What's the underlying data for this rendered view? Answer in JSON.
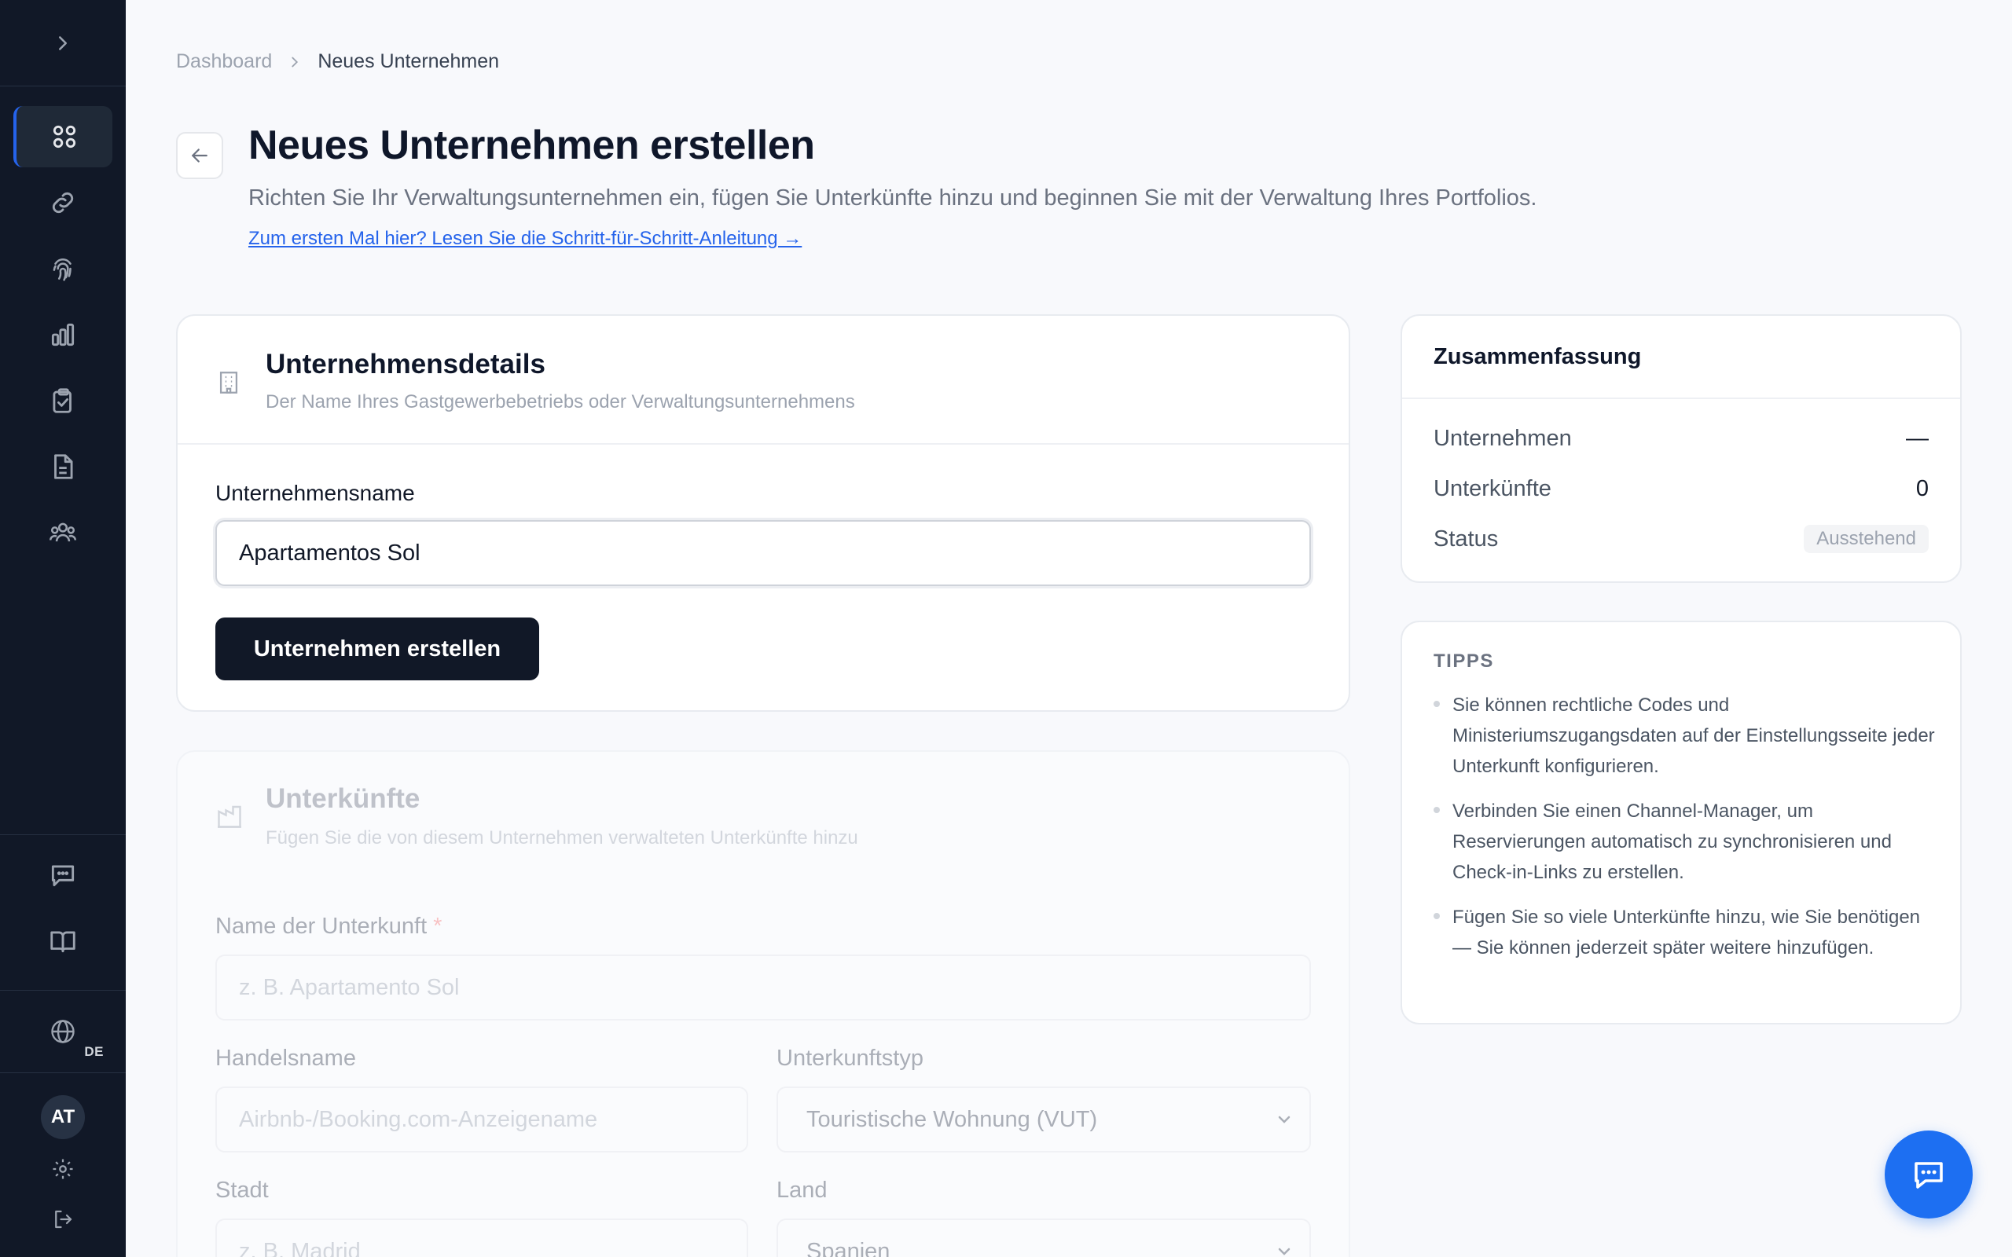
{
  "breadcrumb": {
    "root": "Dashboard",
    "current": "Neues Unternehmen"
  },
  "header": {
    "title": "Neues Unternehmen erstellen",
    "subtitle": "Richten Sie Ihr Verwaltungsunternehmen ein, fügen Sie Unterkünfte hinzu und beginnen Sie mit der Verwaltung Ihres Portfolios.",
    "guide_link": "Zum ersten Mal hier? Lesen Sie die Schritt-für-Schritt-Anleitung →"
  },
  "company_card": {
    "title": "Unternehmensdetails",
    "subtitle": "Der Name Ihres Gastgewerbebetriebs oder Verwaltungsunternehmens",
    "name_label": "Unternehmensname",
    "name_value": "Apartamentos Sol",
    "submit_label": "Unternehmen erstellen"
  },
  "properties_card": {
    "title": "Unterkünfte",
    "subtitle": "Fügen Sie die von diesem Unternehmen verwalteten Unterkünfte hinzu",
    "name_label": "Name der Unterkunft",
    "name_required": "*",
    "name_placeholder": "z. B. Apartamento Sol",
    "trade_label": "Handelsname",
    "trade_placeholder": "Airbnb-/Booking.com-Anzeigename",
    "type_label": "Unterkunftstyp",
    "type_value": "Touristische Wohnung (VUT)",
    "city_label": "Stadt",
    "city_placeholder": "z. B. Madrid",
    "country_label": "Land",
    "country_value": "Spanien"
  },
  "summary": {
    "title": "Zusammenfassung",
    "rows": [
      {
        "label": "Unternehmen",
        "value": "—"
      },
      {
        "label": "Unterkünfte",
        "value": "0"
      },
      {
        "label": "Status",
        "value": "Ausstehend"
      }
    ]
  },
  "tips": {
    "title": "TIPPS",
    "items": [
      "Sie können rechtliche Codes und Ministeriumszugangsdaten auf der Einstellungsseite jeder Unterkunft konfigurieren.",
      "Verbinden Sie einen Channel-Manager, um Reservierungen automatisch zu synchronisieren und Check-in-Links zu erstellen.",
      "Fügen Sie so viele Unterkünfte hinzu, wie Sie benötigen — Sie können jederzeit später weitere hinzufügen."
    ]
  },
  "sidebar": {
    "lang_code": "DE",
    "user_initials": "AT",
    "nav_icons": [
      "grid-icon",
      "link-icon",
      "fingerprint-icon",
      "bar-chart-icon",
      "clipboard-check-icon",
      "document-icon",
      "users-icon"
    ]
  },
  "colors": {
    "sidebar_bg": "#111827",
    "accent": "#2563eb",
    "fab": "#1d6ff2",
    "primary_btn": "#111827"
  }
}
